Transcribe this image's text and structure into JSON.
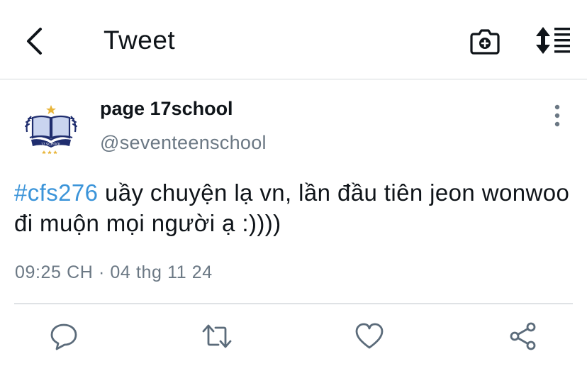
{
  "header": {
    "title": "Tweet",
    "back_icon": "chevron-left-icon",
    "camera_icon": "camera-plus-icon",
    "sort_icon": "sort-icon"
  },
  "tweet": {
    "author_name": "page 17school",
    "handle": "@seventeenschool",
    "hashtag": "#cfs276",
    "text_rest": " uầy chuyện lạ vn, lần đầu tiên jeon wonwoo đi muộn mọi người ạ :))))",
    "timestamp": "09:25 CH · 04 thg 11 24"
  },
  "actions": {
    "reply_icon": "reply-icon",
    "retweet_icon": "retweet-icon",
    "like_icon": "heart-icon",
    "share_icon": "share-icon"
  },
  "colors": {
    "accent": "#3b94d9",
    "text": "#0f1419",
    "muted": "#6b7884",
    "icon": "#5b6b7a",
    "avatar_navy": "#1f2d6e"
  }
}
